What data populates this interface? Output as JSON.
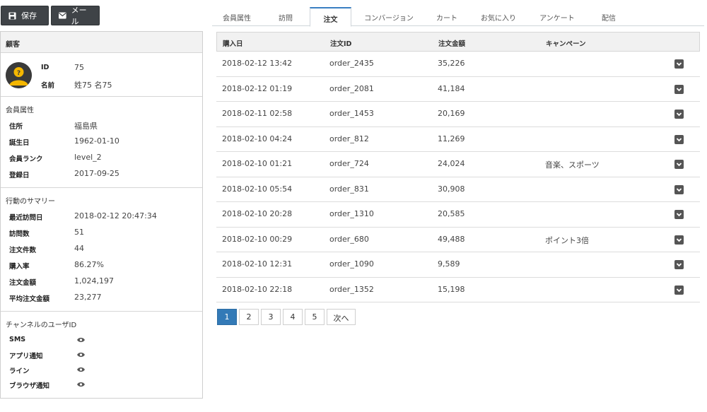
{
  "toolbar": {
    "save_label": "保存",
    "mail_label": "メール"
  },
  "customer_panel": {
    "header": "顧客",
    "identity": [
      {
        "label": "ID",
        "value": "75"
      },
      {
        "label": "名前",
        "value": "姓75 名75"
      }
    ],
    "member_attrs": {
      "title": "会員属性",
      "rows": [
        {
          "label": "住所",
          "value": "福島県"
        },
        {
          "label": "誕生日",
          "value": "1962-01-10"
        },
        {
          "label": "会員ランク",
          "value": "level_2"
        },
        {
          "label": "登録日",
          "value": "2017-09-25"
        }
      ]
    },
    "behavior_summary": {
      "title": "行動のサマリー",
      "rows": [
        {
          "label": "最近訪問日",
          "value": "2018-02-12 20:47:34"
        },
        {
          "label": "訪問数",
          "value": "51"
        },
        {
          "label": "注文件数",
          "value": "44"
        },
        {
          "label": "購入率",
          "value": "86.27%"
        },
        {
          "label": "注文金額",
          "value": "1,024,197"
        },
        {
          "label": "平均注文金額",
          "value": "23,277"
        }
      ]
    },
    "channel_ids": {
      "title": "チャンネルのユーザID",
      "rows": [
        {
          "label": "SMS"
        },
        {
          "label": "アプリ通知"
        },
        {
          "label": "ライン"
        },
        {
          "label": "ブラウザ通知"
        }
      ]
    }
  },
  "tabs": [
    "会員属性",
    "訪問",
    "注文",
    "コンバージョン",
    "カート",
    "お気に入り",
    "アンケート",
    "配信"
  ],
  "active_tab": "注文",
  "orders": {
    "columns": [
      "購入日",
      "注文ID",
      "注文金額",
      "キャンペーン"
    ],
    "rows": [
      {
        "date": "2018-02-12 13:42",
        "id": "order_2435",
        "amount": "35,226",
        "campaign": ""
      },
      {
        "date": "2018-02-12 01:19",
        "id": "order_2081",
        "amount": "41,184",
        "campaign": ""
      },
      {
        "date": "2018-02-11 02:58",
        "id": "order_1453",
        "amount": "20,169",
        "campaign": ""
      },
      {
        "date": "2018-02-10 04:24",
        "id": "order_812",
        "amount": "11,269",
        "campaign": ""
      },
      {
        "date": "2018-02-10 01:21",
        "id": "order_724",
        "amount": "24,024",
        "campaign": "音楽、スポーツ"
      },
      {
        "date": "2018-02-10 05:54",
        "id": "order_831",
        "amount": "30,908",
        "campaign": ""
      },
      {
        "date": "2018-02-10 20:28",
        "id": "order_1310",
        "amount": "20,585",
        "campaign": ""
      },
      {
        "date": "2018-02-10 00:29",
        "id": "order_680",
        "amount": "49,488",
        "campaign": "ポイント3倍"
      },
      {
        "date": "2018-02-10 12:31",
        "id": "order_1090",
        "amount": "9,589",
        "campaign": ""
      },
      {
        "date": "2018-02-10 22:18",
        "id": "order_1352",
        "amount": "15,198",
        "campaign": ""
      }
    ]
  },
  "pagination": {
    "pages": [
      "1",
      "2",
      "3",
      "4",
      "5"
    ],
    "current": "1",
    "next_label": "次へ"
  },
  "colors": {
    "accent": "#337ab7",
    "toolbar_bg": "#3f4347",
    "tab_active_border": "#3a7fc2"
  }
}
